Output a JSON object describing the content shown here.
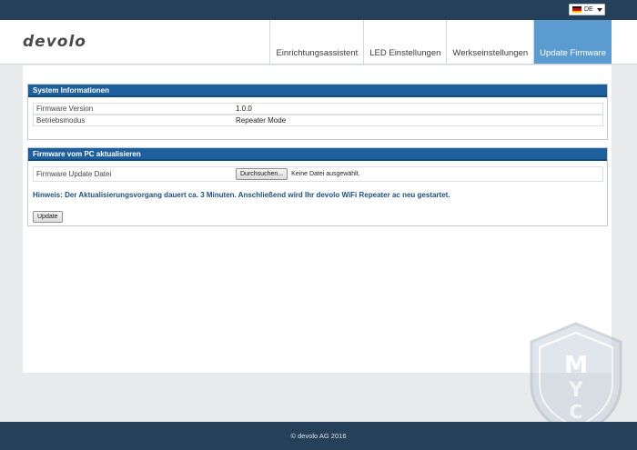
{
  "header": {
    "logo": "devolo",
    "language": "DE",
    "flag_colors": [
      "#000000",
      "#dd0000",
      "#ffce00"
    ]
  },
  "nav": {
    "tabs": [
      {
        "label": "Einrichtungsassistent",
        "active": false
      },
      {
        "label": "LED Einstellungen",
        "active": false
      },
      {
        "label": "Werkseinstellungen",
        "active": false
      },
      {
        "label": "Update Firmware",
        "active": true
      }
    ]
  },
  "system_info": {
    "title": "System Informationen",
    "rows": [
      {
        "key": "Firmware Version",
        "value": "1.0.0"
      },
      {
        "key": "Betriebsmodus",
        "value": "Repeater Mode"
      }
    ]
  },
  "firmware_update": {
    "title": "Firmware vom PC aktualisieren",
    "file_label": "Firmware Update Datei",
    "browse_label": "Durchsuchen...",
    "no_file_text": "Keine Datei ausgewählt.",
    "hint": "Hinweis: Der Aktualisierungsvorgang dauert ca. 3 Minuten. Anschließend wird Ihr devolo WiFi Repeater ac neu gestartet.",
    "update_label": "Update"
  },
  "footer": {
    "text": "© devolo AG 2016"
  },
  "colors": {
    "topbar": "#27405a",
    "panel_header": "#1e5f9e",
    "active_tab": "#5b9bd0",
    "hint_text": "#1e4f80"
  }
}
